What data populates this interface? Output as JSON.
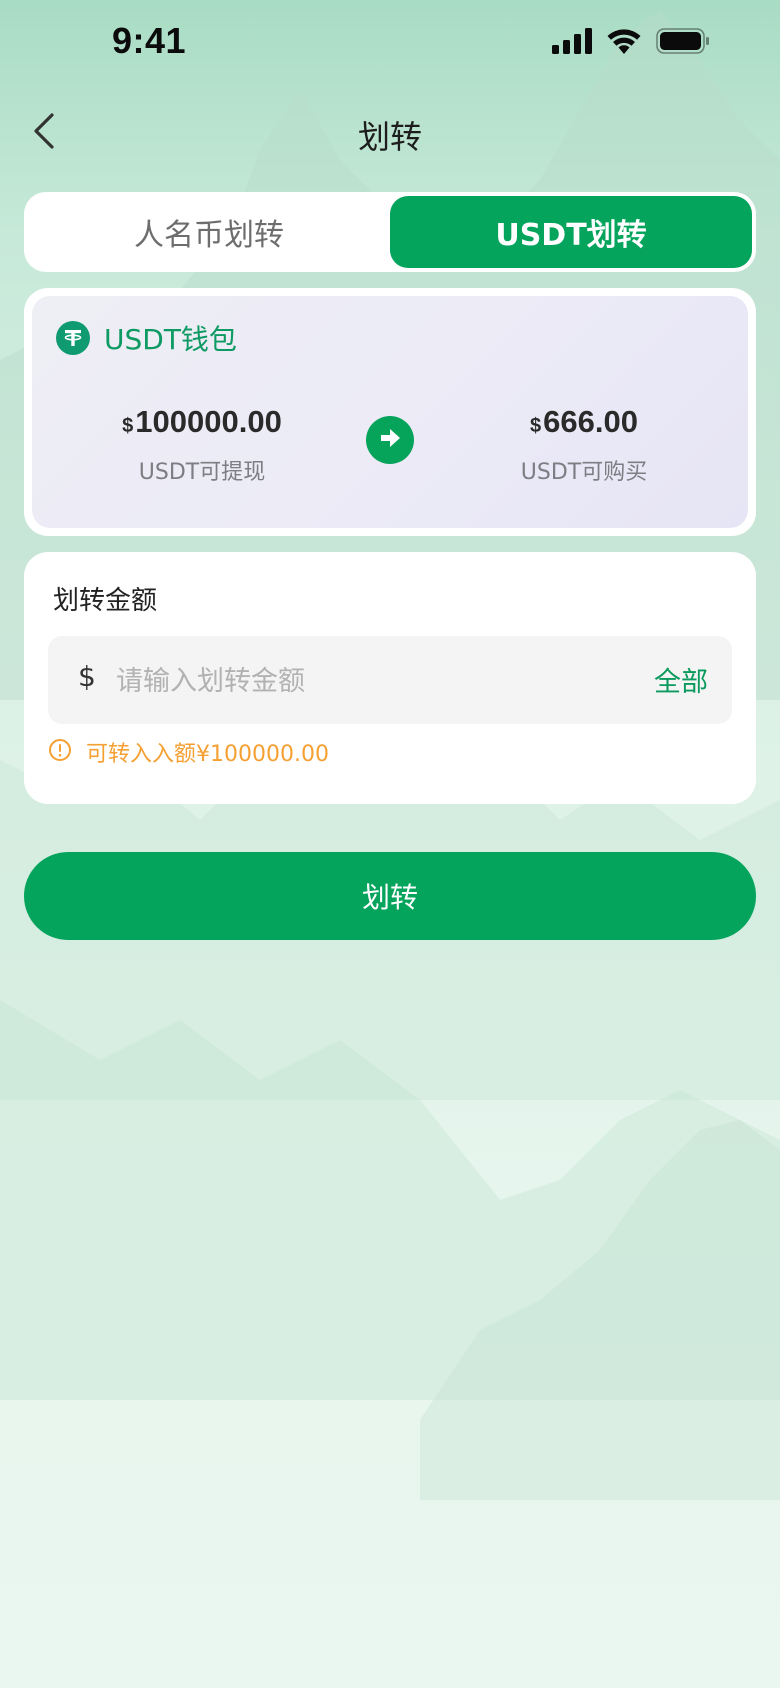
{
  "status_bar": {
    "time": "9:41",
    "icons": [
      "signal-icon",
      "wifi-icon",
      "battery-icon"
    ]
  },
  "nav": {
    "title": "划转",
    "back_icon": "chevron-left-icon"
  },
  "tabs": [
    {
      "label": "人名币划转",
      "active": false
    },
    {
      "label": "USDT划转",
      "active": true
    }
  ],
  "wallet": {
    "title": "USDT钱包",
    "logo_icon": "tether-icon",
    "from": {
      "currency": "$",
      "amount": "100000.00",
      "label": "USDT可提现"
    },
    "to": {
      "currency": "$",
      "amount": "666.00",
      "label": "USDT可购买"
    },
    "arrow_icon": "arrow-right-circle-icon"
  },
  "amount": {
    "title": "划转金额",
    "currency": "$",
    "placeholder": "请输入划转金额",
    "value": "",
    "all_label": "全部",
    "hint_icon": "exclamation-circle-icon",
    "hint": "可转入入额¥100000.00"
  },
  "submit_label": "划转",
  "colors": {
    "primary": "#05a45d",
    "warning": "#f5a033",
    "background": "#dcf1e6",
    "wallet_bg": "#ecebf6"
  }
}
